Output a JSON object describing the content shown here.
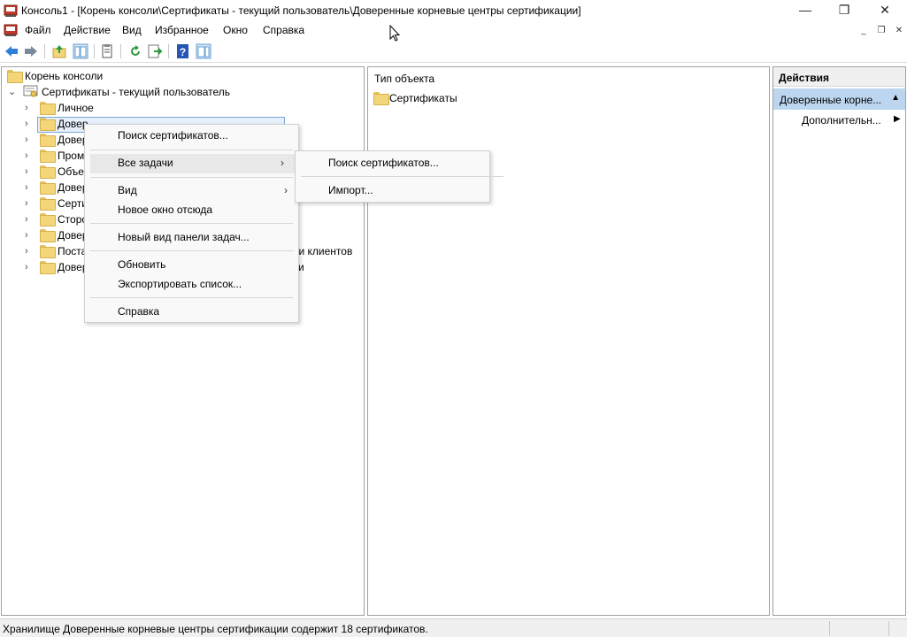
{
  "window": {
    "title": "Консоль1 - [Корень консоли\\Сертификаты - текущий пользователь\\Доверенные корневые центры сертификации]",
    "minimize_glyph": "—",
    "maximize_glyph": "❐",
    "close_glyph": "✕"
  },
  "menu": {
    "items": [
      "Файл",
      "Действие",
      "Вид",
      "Избранное",
      "Окно",
      "Справка"
    ],
    "mdi_minimize": "_",
    "mdi_restore": "❐",
    "mdi_close": "✕"
  },
  "toolbar": {
    "buttons": [
      "back-icon",
      "forward-icon",
      "up-folder-icon",
      "show-hide-tree-icon",
      "properties-icon",
      "refresh-icon",
      "export-list-icon",
      "help-icon",
      "show-hide-action-pane-icon"
    ]
  },
  "tree": {
    "root": "Корень консоли",
    "store": "Сертификаты - текущий пользователь",
    "children": [
      {
        "label": "Личное"
      },
      {
        "label": "Доверенные корневые центры сертификации",
        "visible_prefix": "Довер",
        "selected": true
      },
      {
        "label": "Довер"
      },
      {
        "label": "Пром"
      },
      {
        "label": "Объе"
      },
      {
        "label": "Довер"
      },
      {
        "label": "Серти"
      },
      {
        "label": "Сторо"
      },
      {
        "label": "Довер"
      },
      {
        "label": "Поста",
        "tail": "ти клиентов"
      },
      {
        "label": "Довер",
        "tail": "и"
      }
    ]
  },
  "results": {
    "column_header": "Тип объекта",
    "items": [
      "Сертификаты"
    ]
  },
  "actions": {
    "header": "Действия",
    "section": "Доверенные корне...",
    "item": "Дополнительн..."
  },
  "context_menu": {
    "items": {
      "find": "Поиск сертификатов...",
      "all_tasks": "Все задачи",
      "view": "Вид",
      "new_window": "Новое окно отсюда",
      "new_taskpad": "Новый вид панели задач...",
      "refresh": "Обновить",
      "export": "Экспортировать список...",
      "help": "Справка"
    },
    "submenu": {
      "find": "Поиск сертификатов...",
      "import": "Импорт..."
    }
  },
  "status": {
    "text": "Хранилище Доверенные корневые центры сертификации содержит 18 сертификатов."
  },
  "colors": {
    "accent": "#bcd6f0",
    "selection_border": "#7aa6d6",
    "folder": "#f4d67a"
  }
}
